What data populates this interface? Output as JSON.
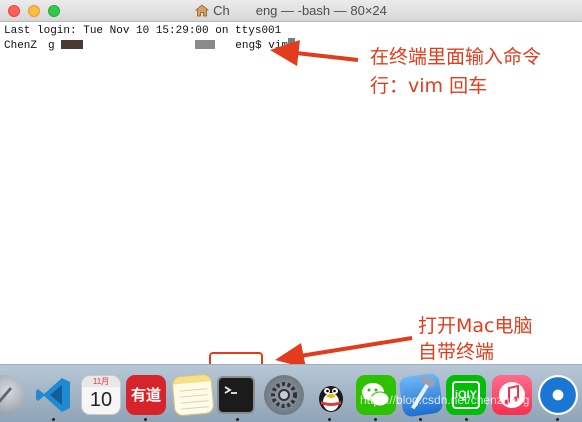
{
  "window": {
    "title": "Ch    eng — -bash — 80×24"
  },
  "terminal": {
    "last_login": "Last login: Tue Nov 10 15:29:00 on ttys001",
    "prompt_start": "ChenZ  g ",
    "prompt_end": "eng$ vim"
  },
  "annotations": {
    "terminal_note_line1": "在终端里面输入命令",
    "terminal_note_line2": "行：vim 回车",
    "dock_note_line1": "打开Mac电脑",
    "dock_note_line2": "自带终端"
  },
  "dock": {
    "calendar_month": "11月",
    "calendar_day": "10",
    "youdao_label": "有道",
    "iqiyi_label": "iQIY"
  },
  "watermark": "https://blog.csdn.net/chenzheng",
  "colors": {
    "annotation": "#e23c1c",
    "dock_background": "#9fb2c4"
  }
}
